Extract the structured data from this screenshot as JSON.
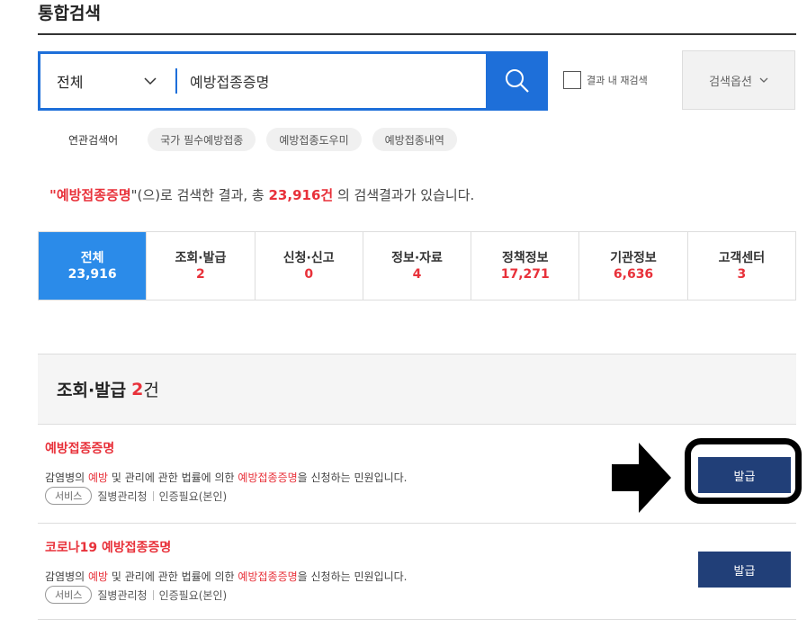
{
  "page": {
    "title": "통합검색"
  },
  "search": {
    "scope": "전체",
    "query": "예방접종증명",
    "recheck_label": "결과 내 재검색",
    "options_label": "검색옵션"
  },
  "related": {
    "label": "연관검색어",
    "tags": [
      "국가 필수예방접종",
      "예방접종도우미",
      "예방접종내역"
    ]
  },
  "summary": {
    "quote_open": "\"",
    "keyword": "예방접종증명",
    "mid": "\"(으)로 검색한 결과, 총 ",
    "count": "23,916건",
    "tail": " 의 검색결과가 있습니다."
  },
  "tabs": [
    {
      "label": "전체",
      "count": "23,916"
    },
    {
      "label": "조회·발급",
      "count": "2"
    },
    {
      "label": "신청·신고",
      "count": "0"
    },
    {
      "label": "정보·자료",
      "count": "4"
    },
    {
      "label": "정책정보",
      "count": "17,271"
    },
    {
      "label": "기관정보",
      "count": "6,636"
    },
    {
      "label": "고객센터",
      "count": "3"
    }
  ],
  "section": {
    "title": "조회·발급",
    "count": "2",
    "unit": "건"
  },
  "items": [
    {
      "title": "예방접종증명",
      "desc_a": "감염병의 ",
      "desc_hl1": "예방",
      "desc_b": " 및 관리에 관한 법률에 의한 ",
      "desc_hl2": "예방접종증명",
      "desc_c": "을 신청하는 민원입니다.",
      "pill": "서비스",
      "agency": "질병관리청",
      "auth": "인증필요(본인)",
      "button": "발급"
    },
    {
      "title": "코로나19 예방접종증명",
      "desc_a": "감염병의 ",
      "desc_hl1": "예방",
      "desc_b": " 및 관리에 관한 법률에 의한 ",
      "desc_hl2": "예방접종증명",
      "desc_c": "을 신청하는 민원입니다.",
      "pill": "서비스",
      "agency": "질병관리청",
      "auth": "인증필요(본인)",
      "button": "발급"
    }
  ],
  "colors": {
    "accent_blue": "#1e6fd9",
    "active_tab": "#2b8be9",
    "highlight_red": "#e8313a",
    "button_navy": "#213f78"
  },
  "icons": {
    "search": "search-icon",
    "chevron": "chevron-down-icon",
    "annotation_arrow": "arrow-right-icon"
  }
}
